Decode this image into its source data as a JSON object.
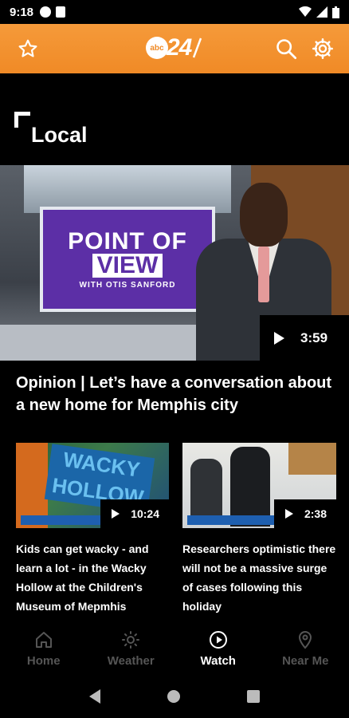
{
  "status_bar": {
    "time": "9:18"
  },
  "app_bar": {
    "logo_small": "abc",
    "logo_number": "24"
  },
  "section": {
    "title": "Local"
  },
  "hero": {
    "screen_line1": "POINT OF",
    "screen_line2": "VIEW",
    "screen_line3": "WITH OTIS SANFORD",
    "duration": "3:59",
    "title": "Opinion | Let’s have a conversation about a new home for Memphis city"
  },
  "cards": [
    {
      "duration": "10:24",
      "title": "Kids can get wacky - and learn a lot - in the Wacky Hollow at the Children's Museum of Mepmhis",
      "thumb_text": "WACKY HOLLOW"
    },
    {
      "duration": "2:38",
      "title": "Researchers optimistic there will not be a massive surge of cases following this holiday"
    }
  ],
  "bottom_nav": [
    {
      "label": "Home",
      "icon": "home-icon",
      "active": false
    },
    {
      "label": "Weather",
      "icon": "sun-icon",
      "active": false
    },
    {
      "label": "Watch",
      "icon": "play-circle-icon",
      "active": true
    },
    {
      "label": "Near Me",
      "icon": "location-pin-icon",
      "active": false
    }
  ],
  "colors": {
    "accent": "#f08a26",
    "background": "#000000",
    "inactive_nav": "#555555"
  }
}
